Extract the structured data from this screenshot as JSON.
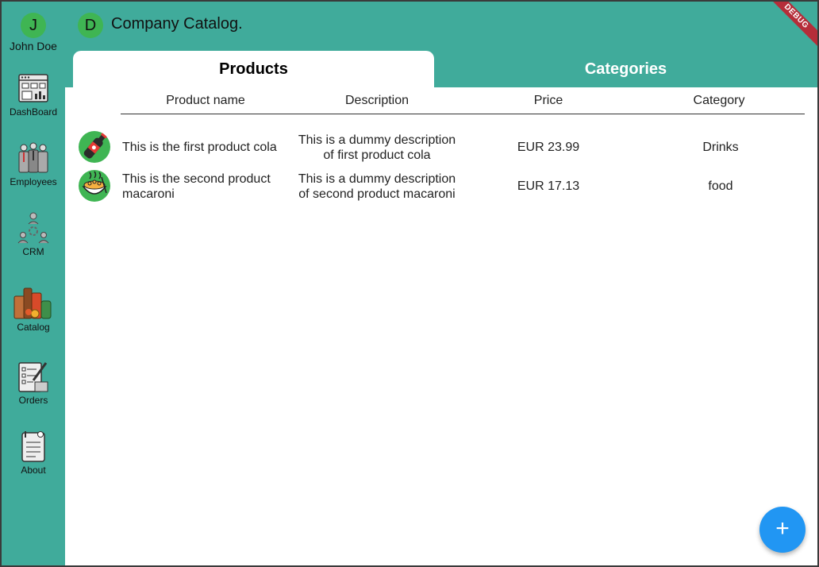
{
  "user": {
    "initial": "J",
    "name": "John Doe"
  },
  "header": {
    "initial": "D",
    "title": "Company Catalog."
  },
  "debug_label": "DEBUG",
  "sidebar": {
    "items": [
      {
        "label": "DashBoard",
        "icon": "dashboard-icon"
      },
      {
        "label": "Employees",
        "icon": "employees-icon"
      },
      {
        "label": "CRM",
        "icon": "crm-icon"
      },
      {
        "label": "Catalog",
        "icon": "catalog-icon"
      },
      {
        "label": "Orders",
        "icon": "orders-icon"
      },
      {
        "label": "About",
        "icon": "about-icon"
      }
    ]
  },
  "tabs": [
    {
      "label": "Products",
      "selected": true
    },
    {
      "label": "Categories",
      "selected": false
    }
  ],
  "table": {
    "columns": [
      "Product name",
      "Description",
      "Price",
      "Category"
    ],
    "rows": [
      {
        "icon": "cola-bottle-icon",
        "name": "This is the first product cola",
        "description_line1": "This is a dummy description",
        "description_line2": "of first product cola",
        "price": "EUR 23.99",
        "category": "Drinks"
      },
      {
        "icon": "macaroni-bowl-icon",
        "name_line1": "This is the second product",
        "name_line2": "macaroni",
        "description_line1": "This is a dummy description",
        "description_line2": "of second product macaroni",
        "price": "EUR 17.13",
        "category": "food"
      }
    ]
  },
  "fab": {
    "icon": "plus-icon",
    "symbol": "+"
  },
  "colors": {
    "teal": "#40ab9b",
    "green_avatar": "#3fb553",
    "fab_blue": "#2196f3",
    "debug_red": "#b52d39"
  }
}
